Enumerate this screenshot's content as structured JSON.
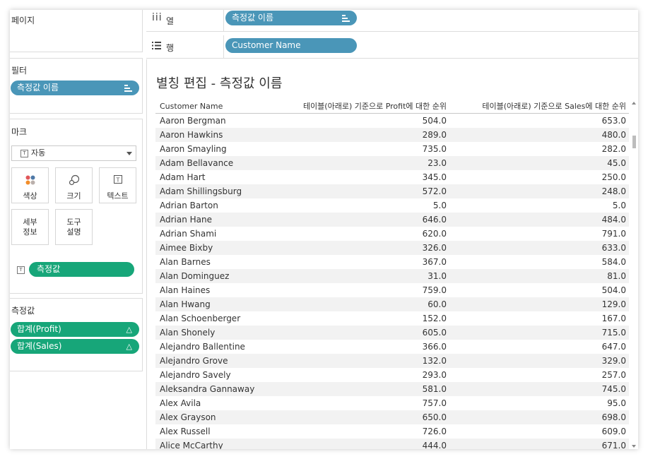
{
  "left_panel": {
    "pages_title": "페이지",
    "filters_title": "필터",
    "filter_pill": "측정값 이름",
    "marks_title": "마크",
    "mark_type": "자동",
    "mark_buttons": {
      "color": "색상",
      "size": "크기",
      "text": "텍스트",
      "detail": "세부\n정보",
      "tooltip": "도구\n설명"
    },
    "marks_pill": "측정값",
    "measures_title": "측정값",
    "measures": [
      "합계(Profit)",
      "합계(Sales)"
    ]
  },
  "shelves": {
    "columns_label": "열",
    "columns_pill": "측정값 이름",
    "rows_label": "행",
    "rows_pill": "Customer Name"
  },
  "view": {
    "title": "별칭 편집 - 측정값 이름",
    "headers": [
      "Customer Name",
      "테이블(아래로) 기준으로 Profit에 대한 순위",
      "테이블(아래로) 기준으로 Sales에 대한 순위"
    ],
    "rows": [
      [
        "Aaron Bergman",
        "504.0",
        "653.0"
      ],
      [
        "Aaron Hawkins",
        "289.0",
        "480.0"
      ],
      [
        "Aaron Smayling",
        "735.0",
        "282.0"
      ],
      [
        "Adam Bellavance",
        "23.0",
        "45.0"
      ],
      [
        "Adam Hart",
        "345.0",
        "250.0"
      ],
      [
        "Adam Shillingsburg",
        "572.0",
        "248.0"
      ],
      [
        "Adrian Barton",
        "5.0",
        "5.0"
      ],
      [
        "Adrian Hane",
        "646.0",
        "484.0"
      ],
      [
        "Adrian Shami",
        "620.0",
        "791.0"
      ],
      [
        "Aimee Bixby",
        "326.0",
        "633.0"
      ],
      [
        "Alan Barnes",
        "367.0",
        "584.0"
      ],
      [
        "Alan Dominguez",
        "31.0",
        "81.0"
      ],
      [
        "Alan Haines",
        "759.0",
        "504.0"
      ],
      [
        "Alan Hwang",
        "60.0",
        "129.0"
      ],
      [
        "Alan Schoenberger",
        "152.0",
        "167.0"
      ],
      [
        "Alan Shonely",
        "605.0",
        "715.0"
      ],
      [
        "Alejandro Ballentine",
        "366.0",
        "647.0"
      ],
      [
        "Alejandro Grove",
        "132.0",
        "329.0"
      ],
      [
        "Alejandro Savely",
        "293.0",
        "257.0"
      ],
      [
        "Aleksandra Gannaway",
        "581.0",
        "745.0"
      ],
      [
        "Alex Avila",
        "757.0",
        "95.0"
      ],
      [
        "Alex Grayson",
        "650.0",
        "698.0"
      ],
      [
        "Alex Russell",
        "726.0",
        "609.0"
      ],
      [
        "Alice McCarthy",
        "444.0",
        "671.0"
      ]
    ]
  },
  "colors": {
    "blue_pill": "#4a96b8",
    "green_pill": "#17a679"
  }
}
